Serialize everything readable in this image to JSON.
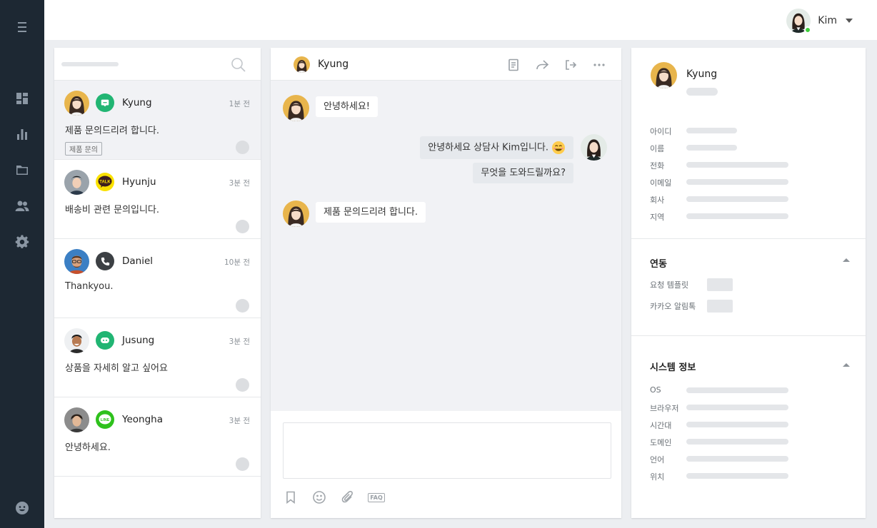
{
  "user": {
    "name": "Kim",
    "status_color": "#3fcf3c"
  },
  "nav": {
    "icons": [
      "menu-icon",
      "dashboard-icon",
      "stats-icon",
      "folder-icon",
      "users-icon",
      "gear-icon",
      "bot-icon"
    ]
  },
  "conversations": [
    {
      "name": "Kyung",
      "time": "1분 전",
      "message": "제품 문의드리려 합니다.",
      "tag": "제품 문의",
      "channel": "chat",
      "channel_color": "#21b573",
      "active": true
    },
    {
      "name": "Hyunju",
      "time": "3분 전",
      "message": "배송비 관련 문의입니다.",
      "channel": "kakaotalk",
      "channel_color": "#fae100",
      "channel_label": "TALK"
    },
    {
      "name": "Daniel",
      "time": "10분 전",
      "message": "Thankyou.",
      "channel": "phone",
      "channel_color": "#3c4044"
    },
    {
      "name": "Jusung",
      "time": "3분 전",
      "message": "상품을 자세히 알고 싶어요",
      "channel": "talk-talk",
      "channel_color": "#21b573"
    },
    {
      "name": "Yeongha",
      "time": "3분 전",
      "message": "안녕하세요.",
      "channel": "line",
      "channel_color": "#2ec11c",
      "channel_label": "LINE"
    }
  ],
  "chat": {
    "title": "Kyung",
    "messages": [
      {
        "from": "customer",
        "text": "안녕하세요!"
      },
      {
        "from": "agent",
        "text": "안녕하세요 상담사 Kim입니다."
      },
      {
        "from": "agent",
        "text": "무엇을 도와드릴까요?"
      },
      {
        "from": "customer",
        "text": "제품 문의드리려 합니다."
      }
    ],
    "faq_label": "FAQ"
  },
  "profile": {
    "name": "Kyung",
    "fields": [
      "아이디",
      "이름",
      "전화",
      "이메일",
      "회사",
      "지역"
    ]
  },
  "integration": {
    "title": "연동",
    "items": [
      "요청 템플릿",
      "카카오 알림톡"
    ]
  },
  "system": {
    "title": "시스템 정보",
    "fields": [
      "OS",
      "브라우저",
      "시간대",
      "도메인",
      "언어",
      "위치"
    ]
  }
}
